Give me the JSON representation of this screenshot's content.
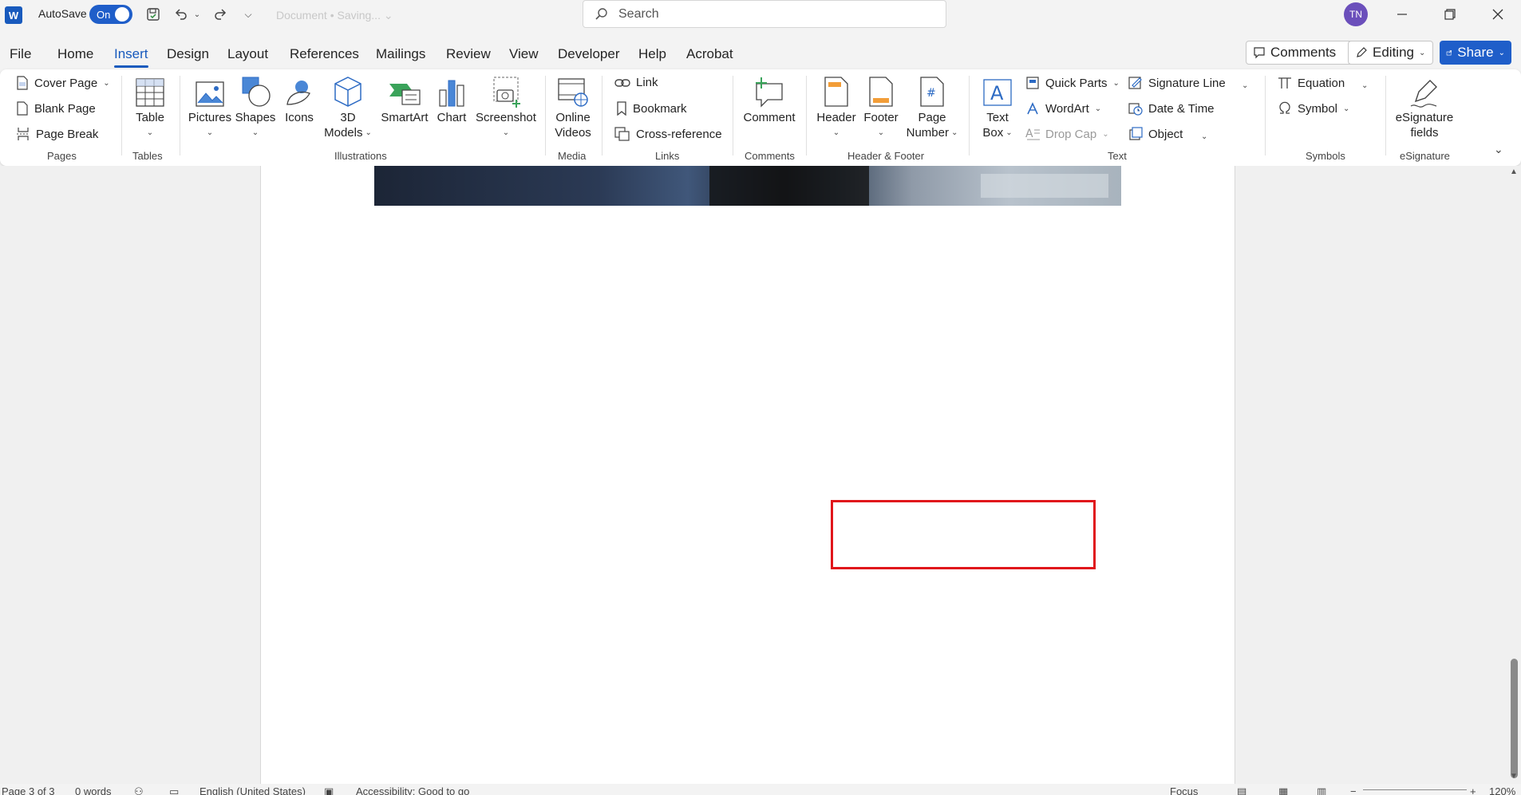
{
  "titlebar": {
    "app_icon": "W",
    "autosave_label": "AutoSave",
    "autosave_state": "On",
    "doc_title": "Document  •  Saving...  ⌄",
    "search_placeholder": "Search",
    "avatar_initials": "TN"
  },
  "menu": {
    "tabs": [
      "File",
      "Home",
      "Insert",
      "Design",
      "Layout",
      "References",
      "Mailings",
      "Review",
      "View",
      "Developer",
      "Help",
      "Acrobat"
    ],
    "active_tab": "Insert",
    "comments_label": "Comments",
    "editing_label": "Editing",
    "share_label": "Share"
  },
  "ribbon": {
    "pages": {
      "cover_page": "Cover Page",
      "blank_page": "Blank Page",
      "page_break": "Page Break",
      "group": "Pages"
    },
    "tables": {
      "table": "Table",
      "group": "Tables"
    },
    "illustrations": {
      "pictures": "Pictures",
      "shapes": "Shapes",
      "icons": "Icons",
      "models_line1": "3D",
      "models_line2": "Models",
      "smartart": "SmartArt",
      "chart": "Chart",
      "screenshot": "Screenshot",
      "group": "Illustrations"
    },
    "media": {
      "online_line1": "Online",
      "online_line2": "Videos",
      "group": "Media"
    },
    "links": {
      "link": "Link",
      "bookmark": "Bookmark",
      "cross_reference": "Cross-reference",
      "group": "Links"
    },
    "comments": {
      "comment": "Comment",
      "group": "Comments"
    },
    "header_footer": {
      "header": "Header",
      "footer": "Footer",
      "page_line1": "Page",
      "page_line2": "Number",
      "group": "Header & Footer"
    },
    "text": {
      "textbox_line1": "Text",
      "textbox_line2": "Box",
      "quick_parts": "Quick Parts",
      "wordart": "WordArt",
      "drop_cap": "Drop Cap",
      "signature_line": "Signature Line",
      "date_time": "Date & Time",
      "object": "Object",
      "group": "Text"
    },
    "symbols": {
      "equation": "Equation",
      "symbol": "Symbol",
      "group": "Symbols"
    },
    "esignature": {
      "fields_line1": "eSignature",
      "fields_line2": "fields",
      "group": "eSignature"
    }
  },
  "status": {
    "page": "Page 3 of 3",
    "words": "0 words",
    "language": "English (United States)",
    "accessibility": "Accessibility: Good to go",
    "focus": "Focus",
    "zoom": "120%"
  },
  "colors": {
    "accent": "#185abd",
    "highlight_box": "#e0161b"
  }
}
